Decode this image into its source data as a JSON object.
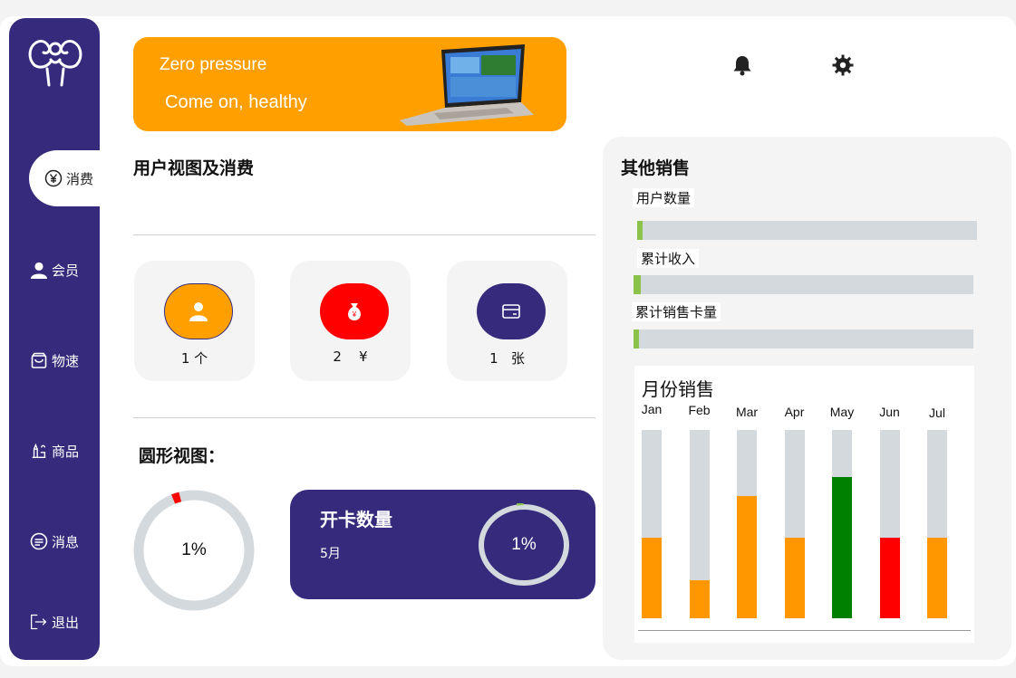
{
  "sidebar": {
    "items": [
      {
        "label": "消费",
        "icon": "yen-icon"
      },
      {
        "label": "会员",
        "icon": "user-icon"
      },
      {
        "label": "物速",
        "icon": "shopping-bag-icon"
      },
      {
        "label": "商品",
        "icon": "goods-icon"
      },
      {
        "label": "消息",
        "icon": "message-icon"
      },
      {
        "label": "退出",
        "icon": "logout-icon"
      }
    ],
    "active_index": 0
  },
  "banner": {
    "line1": "Zero pressure",
    "line2": "Come on, healthy",
    "color": "#ffa000"
  },
  "header_icons": [
    "bell-icon",
    "gear-icon"
  ],
  "user_view": {
    "title": "用户视图及消费",
    "stats": [
      {
        "value": "1",
        "unit": "个",
        "icon": "user-icon",
        "color": "#ffa000"
      },
      {
        "value": "2",
        "unit": "¥",
        "icon": "money-bag-icon",
        "color": "#ff0000"
      },
      {
        "value": "1",
        "unit": "张",
        "icon": "card-icon",
        "color": "#352a7c"
      }
    ]
  },
  "circle_view": {
    "title": "圆形视图：",
    "donut_label": "1%",
    "donut_value": 0.01
  },
  "card_count": {
    "title": "开卡数量",
    "month": "5月",
    "ring_label": "1%",
    "ring_value": 0.01
  },
  "other_sales": {
    "title": "其他销售",
    "bars": [
      {
        "label": "用户数量",
        "value": 0.01
      },
      {
        "label": "累计收入",
        "value": 0.02
      },
      {
        "label": "累计销售卡量",
        "value": 0.01
      }
    ]
  },
  "chart_data": {
    "type": "bar",
    "title": "月份销售",
    "categories": [
      "Jan",
      "Feb",
      "Mar",
      "Apr",
      "May",
      "Jun",
      "Jul"
    ],
    "values": [
      43,
      20,
      65,
      43,
      75,
      43,
      43
    ],
    "ylim": [
      0,
      100
    ],
    "colors": [
      "#ff9800",
      "#ff9800",
      "#ff9800",
      "#ff9800",
      "#008000",
      "#ff0000",
      "#ff9800"
    ],
    "track_color": "#d4d9de"
  },
  "colors": {
    "brand": "#352a7c",
    "accent": "#ffa000",
    "alert": "#ff0000",
    "success": "#8bc34a"
  }
}
